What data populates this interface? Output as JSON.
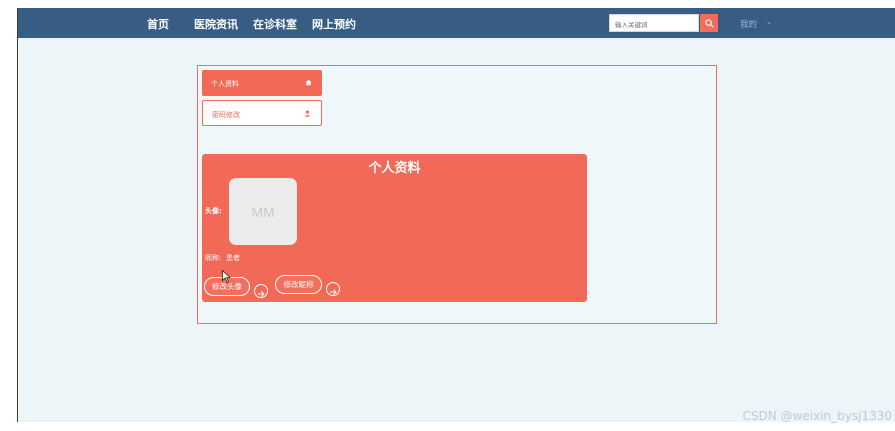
{
  "nav": {
    "links": [
      "首页",
      "医院资讯",
      "在诊科室",
      "网上预约"
    ],
    "search_placeholder": "输入关键词",
    "user_menu": "我的",
    "user_menu_caret": "⌄"
  },
  "sidebar": {
    "items": [
      {
        "label": "个人资料",
        "icon": "home-icon",
        "active": true
      },
      {
        "label": "密码修改",
        "icon": "user-icon",
        "active": false
      }
    ]
  },
  "profile_card": {
    "title": "个人资料",
    "avatar_label": "头像:",
    "avatar_placeholder": "MM",
    "nickname_label": "昵称:",
    "nickname_value": "患者",
    "change_avatar_button": "修改头像",
    "change_nickname_button": "修改昵称"
  },
  "watermark": "CSDN @weixin_bysj1330",
  "colors": {
    "nav_bg": "#375d85",
    "accent": "#f36957",
    "page_bg": "#eef5f8"
  }
}
